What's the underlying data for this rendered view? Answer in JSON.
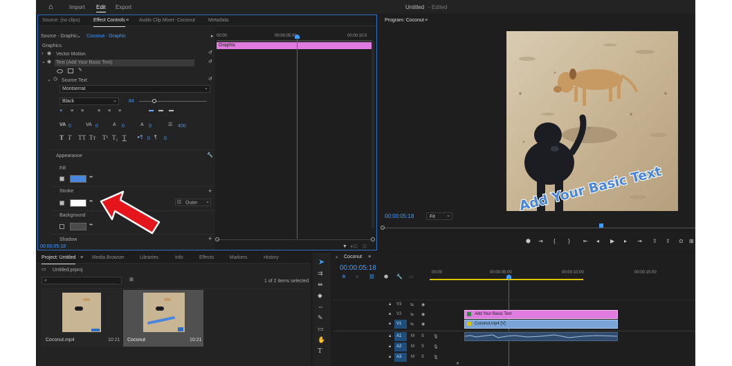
{
  "topbar": {
    "home": "⌂",
    "import": "Import",
    "edit": "Edit",
    "export": "Export",
    "title": "Untitled",
    "edited": "- Edited"
  },
  "source_panel": {
    "tabs": [
      "Source: (no clips)",
      "Effect Controls",
      "Audio Clip Mixer: Coconut",
      "Metadata"
    ],
    "source_label": "Source - Graphic",
    "clip_label": "Coconut - Graphic",
    "ruler": [
      "00:00",
      "00:00:05:00",
      "00:00:10:0"
    ],
    "graphic_bar": "Graphic",
    "section": "Graphics",
    "vector_motion": "Vector Motion",
    "text_layer": "Text (Add Your Basic Text)",
    "source_text": "Source Text",
    "font": "Montserrat",
    "font_style": "Black",
    "font_size": "84",
    "tracking_values": [
      "0",
      "0",
      "0",
      "0",
      "400"
    ],
    "kerning_values": [
      "0",
      "0"
    ],
    "appearance": "Appearance",
    "fill": "Fill",
    "stroke": "Stroke",
    "stroke_position": "Outer",
    "background": "Background",
    "shadow": "Shadow",
    "timecode": "00:00:05:18",
    "fill_color": "#4a86d9",
    "stroke_color": "#ffffff"
  },
  "program_panel": {
    "title": "Program: Coconut",
    "timecode": "00:00:05:18",
    "fit": "Fit",
    "overlay_text": "Add Your Basic Text"
  },
  "project_panel": {
    "tabs": [
      "Project: Untitled",
      "Media Browser",
      "Libraries",
      "Info",
      "Effects",
      "Markers",
      "History"
    ],
    "project_file": "Untitled.prproj",
    "items_selected": "1 of 2 items selected",
    "items": [
      {
        "name": "Coconut.mp4",
        "duration": "10:21"
      },
      {
        "name": "Coconut",
        "duration": "10:21"
      }
    ]
  },
  "timeline": {
    "title": "Coconut",
    "timecode": "00:00:05:18",
    "ruler": [
      "00:00",
      "00:00:05:00",
      "00:00:10:00",
      "00:00:15:00"
    ],
    "tracks": [
      "V3",
      "V2",
      "V1",
      "A1",
      "A2",
      "A3"
    ],
    "video_targets": [
      "V1"
    ],
    "audio_targets": [
      "A1",
      "A2",
      "A3"
    ],
    "text_clip": "Add Your Basic Text",
    "video_clip": "Coconut.mp4 [V]",
    "text_clip_color": "#e07be0",
    "video_clip_color": "#7aa4d6"
  },
  "accent": "#3f9cff"
}
